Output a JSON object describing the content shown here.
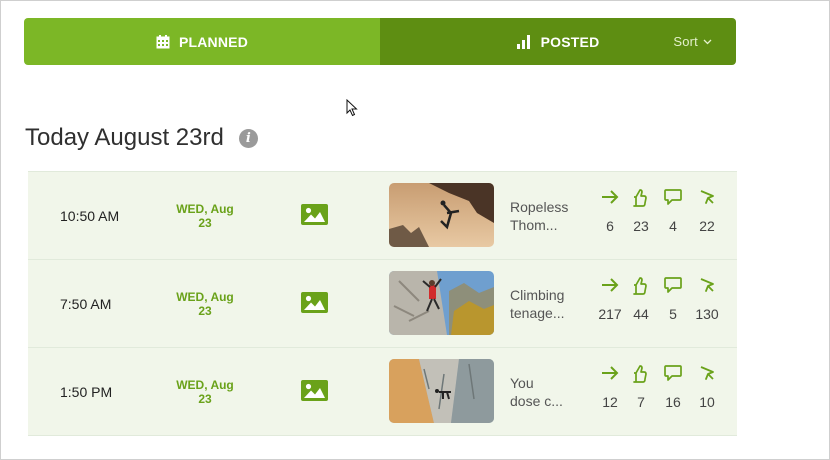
{
  "colors": {
    "planned_bg": "#7cb726",
    "posted_bg": "#5e8e12",
    "accent": "#6aa21a",
    "row_bg": "#f1f6ea"
  },
  "tabs": {
    "planned": {
      "label": "PLANNED",
      "icon": "calendar-icon"
    },
    "posted": {
      "label": "POSTED",
      "icon": "bar-chart-icon"
    },
    "sort_label": "Sort"
  },
  "heading": {
    "title": "Today August 23rd",
    "info_icon": "info-icon",
    "info_glyph": "i"
  },
  "stat_icons": [
    "share-arrow-icon",
    "like-hand-icon",
    "comment-icon",
    "click-cursor-icon"
  ],
  "posts": [
    {
      "time": "10:50 AM",
      "date_line1": "WED, Aug",
      "date_line2": "23",
      "media_icon": "image-icon",
      "thumb": "photo-climber-overhang",
      "caption_line1": "Ropeless",
      "caption_line2": "Thom...",
      "shares": "6",
      "likes": "23",
      "comments": "4",
      "clicks": "22"
    },
    {
      "time": "7:50 AM",
      "date_line1": "WED, Aug",
      "date_line2": "23",
      "media_icon": "image-icon",
      "thumb": "photo-climber-rock-face",
      "caption_line1": "Climbing",
      "caption_line2": "tenage...",
      "shares": "217",
      "likes": "44",
      "comments": "5",
      "clicks": "130"
    },
    {
      "time": "1:50 PM",
      "date_line1": "WED, Aug",
      "date_line2": "23",
      "media_icon": "image-icon",
      "thumb": "photo-climber-cliff",
      "caption_line1": "You",
      "caption_line2": "dose c...",
      "shares": "12",
      "likes": "7",
      "comments": "16",
      "clicks": "10"
    }
  ]
}
